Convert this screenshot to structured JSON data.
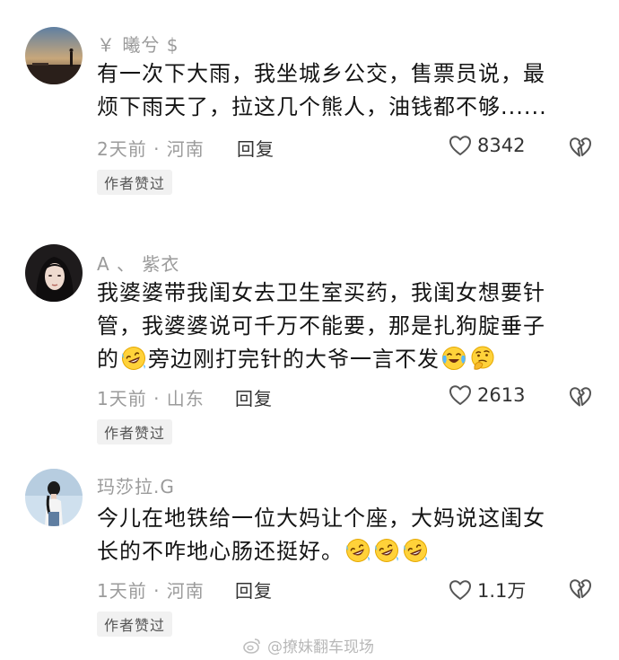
{
  "comments": [
    {
      "username": "￥ 曦兮 $",
      "content_lines": [
        "有一次下大雨，我坐城乡公交，售票员说，最",
        "烦下雨天了，拉这几个熊人，油钱都不够......"
      ],
      "meta": "2天前 · 河南",
      "reply_label": "回复",
      "like_count": "8342",
      "badge": "作者赞过"
    },
    {
      "username": "A 、  紫衣",
      "content_lines": [
        "我婆婆带我闺女去卫生室买药，我闺女想要针",
        "管，我婆婆说可千万不能要，那是扎狗腚垂子"
      ],
      "content_line3_part1": "的",
      "content_line3_part2": "旁边刚打完针的大爷一言不发",
      "meta": "1天前 · 山东",
      "reply_label": "回复",
      "like_count": "2613",
      "badge": "作者赞过"
    },
    {
      "username": "玛莎拉.G",
      "content_lines": [
        "今儿在地铁给一位大妈让个座，大妈说这闺女"
      ],
      "content_line2_text": "长的不咋地心肠还挺好。",
      "meta": "1天前 · 河南",
      "reply_label": "回复",
      "like_count": "1.1万",
      "badge": "作者赞过"
    }
  ],
  "watermark": "@撩妹翻车现场",
  "icons": {
    "like": "heart-outline-icon",
    "dislike": "broken-heart-icon",
    "laugh_emoji": "rolling-laughing-emoji",
    "cry_emoji": "crying-laughing-emoji",
    "thinking_emoji": "thinking-emoji",
    "weibo": "weibo-logo-icon"
  }
}
